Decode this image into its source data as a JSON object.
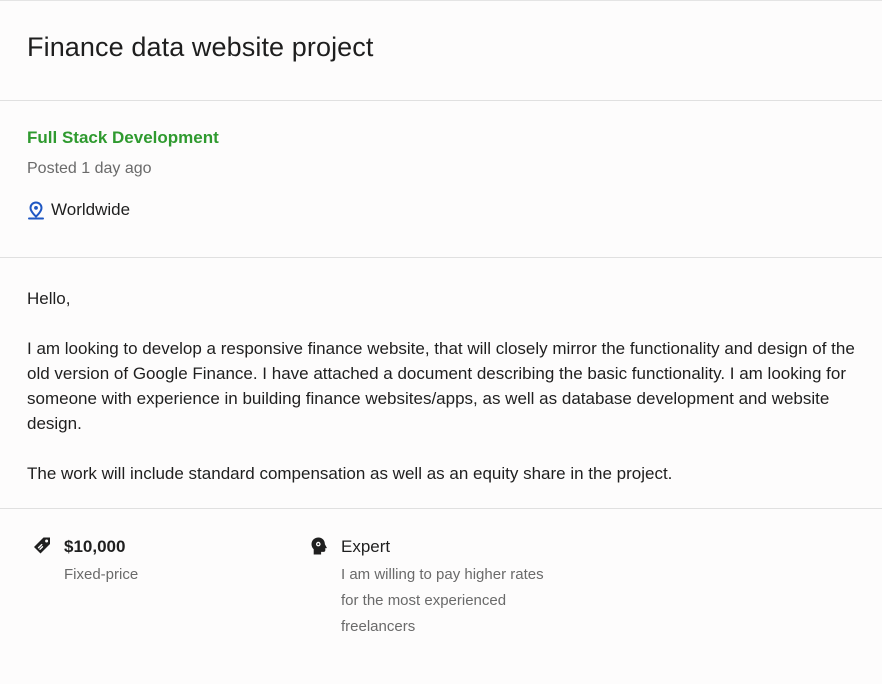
{
  "header": {
    "title": "Finance data website project"
  },
  "meta": {
    "category": "Full Stack Development",
    "posted": "Posted 1 day ago",
    "location": "Worldwide",
    "location_icon": "location-pin-icon"
  },
  "description": {
    "greeting": "Hello,",
    "paragraph_1": "I am looking to develop a responsive finance website, that will closely mirror the functionality and design of the old version of Google Finance. I have attached a document describing the basic functionality. I am looking for someone with experience in building finance websites/apps, as well as database development and website design.",
    "paragraph_2": "The work will include standard compensation as well as an equity share in the project."
  },
  "details": {
    "budget": {
      "amount": "$10,000",
      "type": "Fixed-price",
      "icon": "price-tag-icon"
    },
    "level": {
      "label": "Expert",
      "description": "I am willing to pay higher rates for the most experienced freelancers",
      "icon": "expert-head-icon"
    }
  },
  "colors": {
    "category": "#2f9a2f",
    "icon": "#1f1f1f",
    "location_icon": "#1f57c3"
  }
}
